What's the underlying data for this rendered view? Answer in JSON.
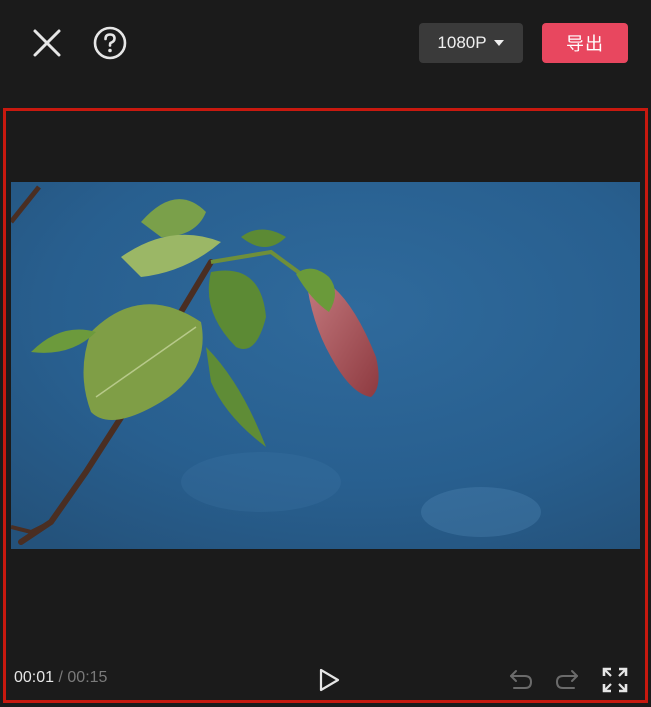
{
  "toolbar": {
    "close_icon": "close-icon",
    "help_icon": "help-icon",
    "resolution": "1080P",
    "export_label": "导出",
    "export_color": "#e8475f"
  },
  "player": {
    "current_time": "00:01",
    "separator": "/",
    "total_time": "00:15",
    "icons": [
      "play-icon",
      "undo-icon",
      "redo-icon",
      "fullscreen-icon"
    ],
    "frame_border_color": "#c8190f"
  }
}
